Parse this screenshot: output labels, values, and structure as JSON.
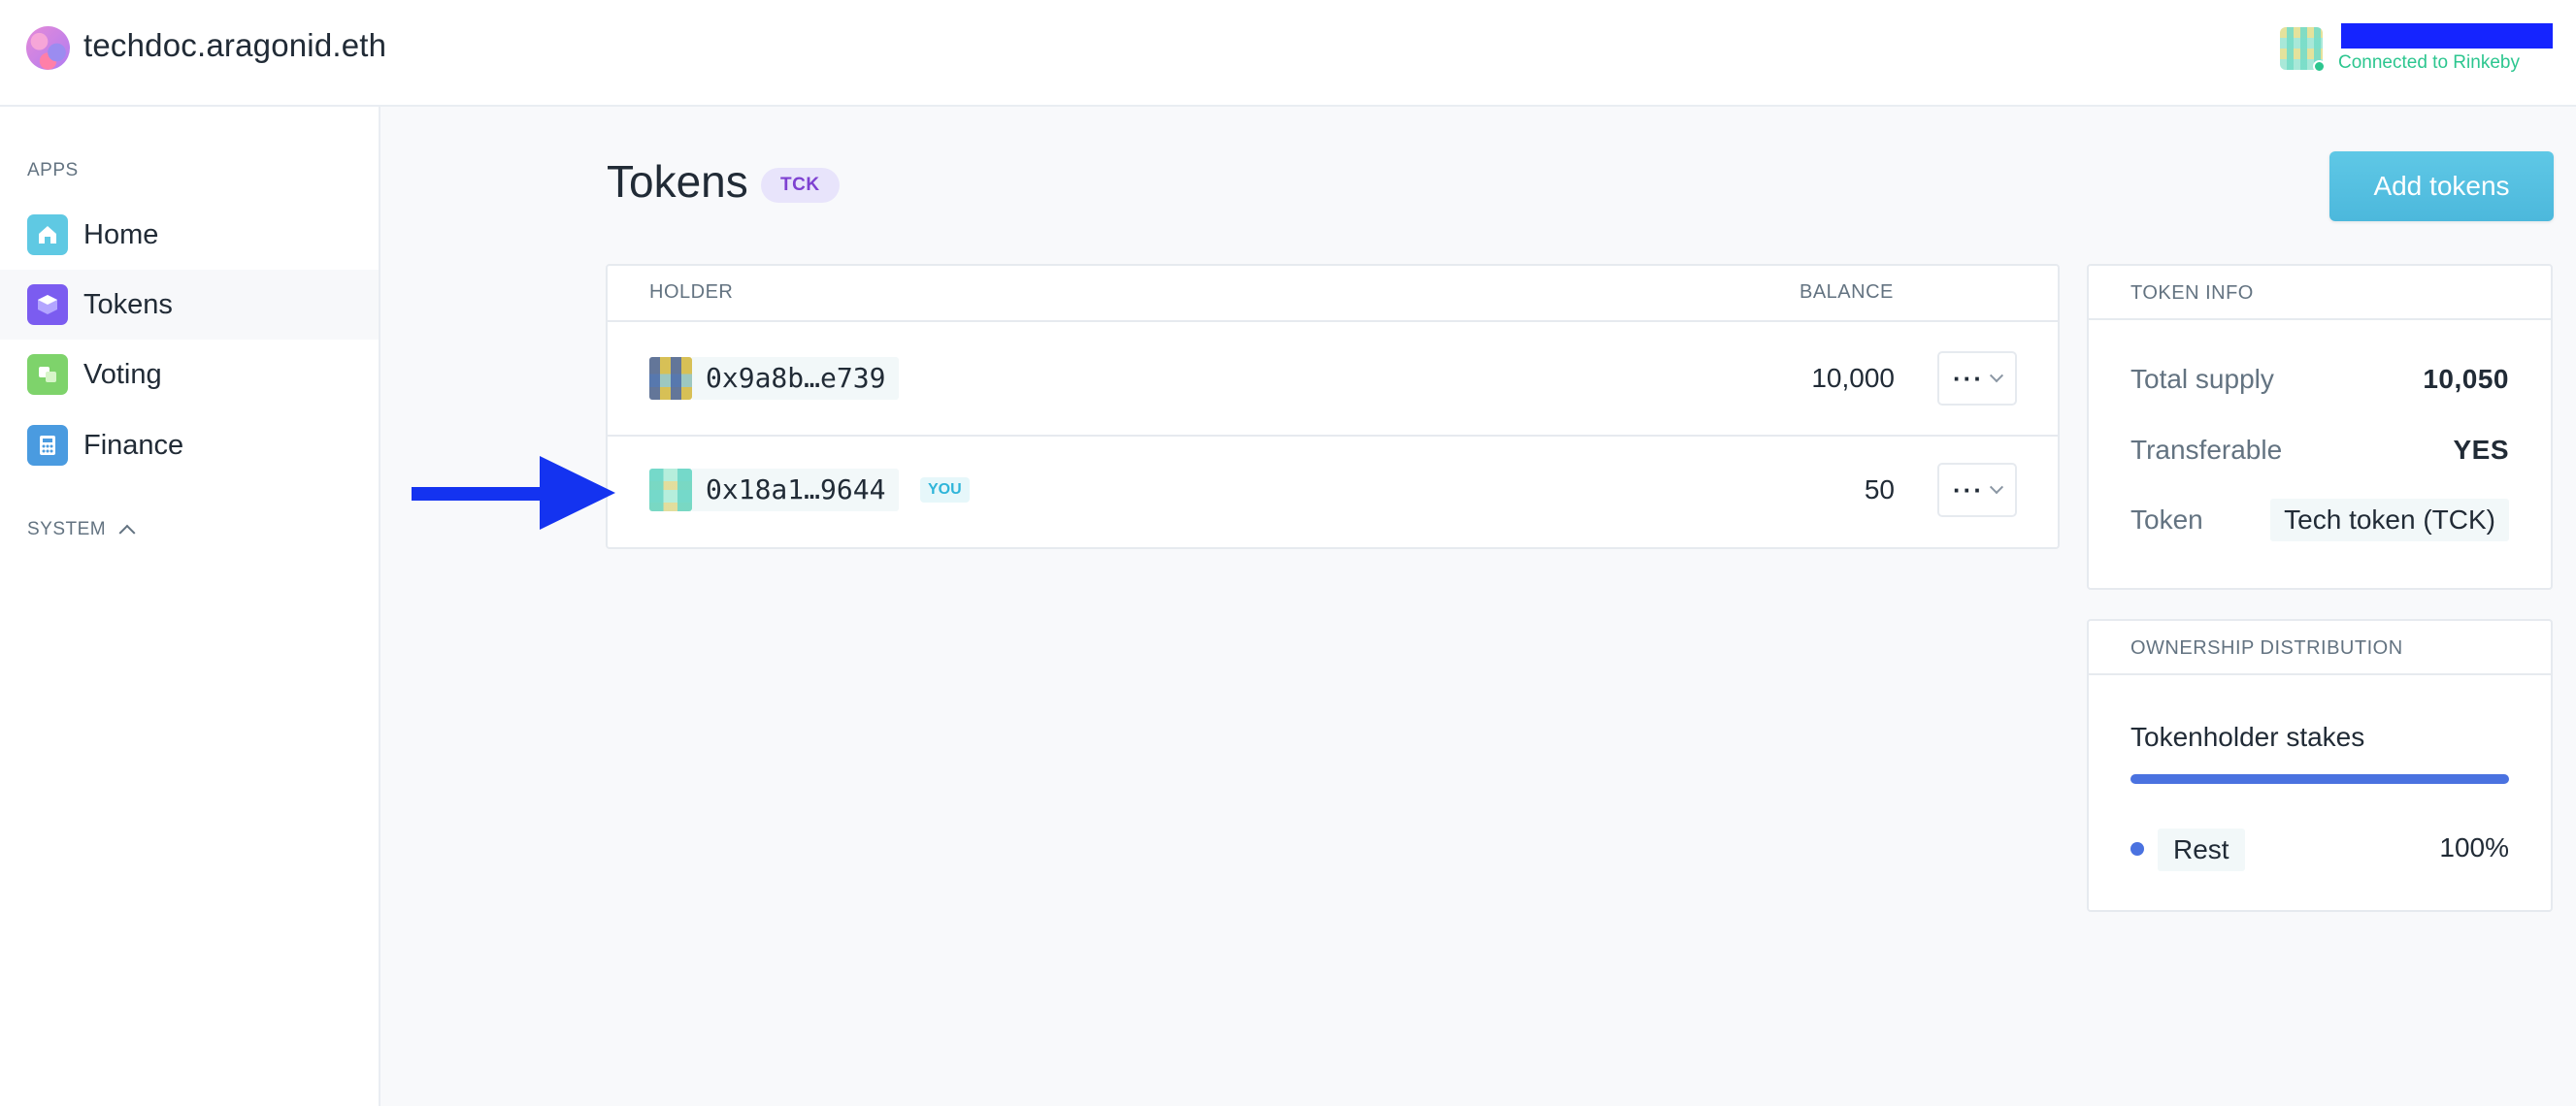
{
  "header": {
    "org_name": "techdoc.aragonid.eth",
    "account_status": "Connected to Rinkeby"
  },
  "sidebar": {
    "apps_heading": "APPS",
    "items": [
      {
        "label": "Home",
        "icon": "home-icon",
        "color": "#5fc9e3"
      },
      {
        "label": "Tokens",
        "icon": "tokens-icon",
        "color": "#7b5cf0"
      },
      {
        "label": "Voting",
        "icon": "voting-icon",
        "color": "#7ed36b"
      },
      {
        "label": "Finance",
        "icon": "finance-icon",
        "color": "#4a9be0"
      }
    ],
    "system_heading": "SYSTEM"
  },
  "main": {
    "title": "Tokens",
    "symbol": "TCK",
    "add_button": "Add tokens",
    "table": {
      "col_holder": "HOLDER",
      "col_balance": "BALANCE",
      "rows": [
        {
          "address": "0x9a8b…e739",
          "balance": "10,000",
          "you": ""
        },
        {
          "address": "0x18a1…9644",
          "balance": "50",
          "you": "YOU"
        }
      ]
    },
    "menu_dots": "···"
  },
  "token_info": {
    "heading": "TOKEN INFO",
    "total_supply_label": "Total supply",
    "total_supply": "10,050",
    "transferable_label": "Transferable",
    "transferable": "YES",
    "token_label": "Token",
    "token": "Tech token (TCK)"
  },
  "ownership": {
    "heading": "OWNERSHIP DISTRIBUTION",
    "stakes_title": "Tokenholder stakes",
    "stakes_fill_fraction": 1.0,
    "legend_label": "Rest",
    "legend_pct": "100%"
  },
  "colors": {
    "accent": "#4cb8dc",
    "success": "#2cc68f",
    "stakes": "#4a72e0",
    "annotation_arrow": "#1433f0"
  }
}
